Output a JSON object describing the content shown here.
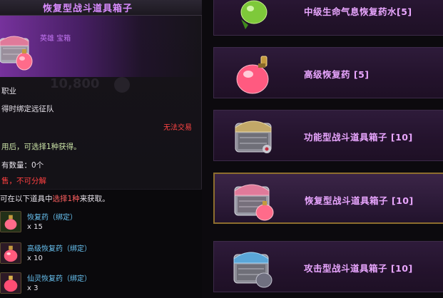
{
  "tooltip": {
    "title": "恢复型战斗道具箱子",
    "type_label": "英雄 宝箱",
    "price": "10,800",
    "lines": {
      "job": "职业",
      "bind": "得时绑定远征队",
      "trade": "无法交易",
      "use": "用后，可选择1种获得。",
      "count": "有数量：0个",
      "sell": "售，不可分解"
    },
    "rewards_header_prefix": "可在以下道具中",
    "rewards_header_highlight": "选择1种",
    "rewards_header_suffix": "来获取。",
    "rewards": [
      {
        "name": "恢复药（绑定）",
        "qty": "x 15",
        "icon": "potion-icon"
      },
      {
        "name": "高级恢复药（绑定）",
        "qty": "x 10",
        "icon": "potion-icon"
      },
      {
        "name": "仙灵恢复药（绑定）",
        "qty": "x 3",
        "icon": "potion-icon"
      }
    ]
  },
  "list": {
    "items": [
      {
        "label": "中级生命气息恢复药水[5]",
        "icon": "green-potion-icon",
        "selected": false
      },
      {
        "label": "高级恢复药 [5]",
        "icon": "pink-potion-icon",
        "selected": false
      },
      {
        "label": "功能型战斗道具箱子 [10]",
        "icon": "chest-icon",
        "selected": false
      },
      {
        "label": "恢复型战斗道具箱子 [10]",
        "icon": "chest-potion-icon",
        "selected": true
      },
      {
        "label": "攻击型战斗道具箱子 [10]",
        "icon": "chest-blue-icon",
        "selected": false
      }
    ]
  },
  "colors": {
    "title": "#d98cff",
    "label": "#e9a6ff",
    "warning": "#ff4040",
    "reward_name": "#69c4f4",
    "selected_border": "#8d6e2e"
  }
}
